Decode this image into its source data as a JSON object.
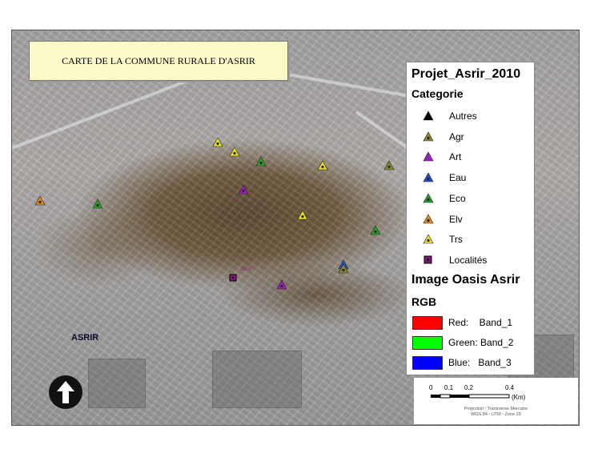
{
  "title": "CARTE DE LA COMMUNE RURALE D'ASRIR",
  "place_label": "ASRIR",
  "locality_label": "Asrir",
  "legend": {
    "title": "Projet_Asrir_2010",
    "subtitle": "Categorie",
    "items": [
      {
        "label": "Autres",
        "symbol": "triangle",
        "color": "#000000"
      },
      {
        "label": "Agr",
        "symbol": "triangle-dot",
        "color": "#8a8a2a"
      },
      {
        "label": "Art",
        "symbol": "triangle",
        "color": "#9b1fb7"
      },
      {
        "label": "Eau",
        "symbol": "triangle-dot",
        "color": "#2050c8"
      },
      {
        "label": "Eco",
        "symbol": "triangle-dot",
        "color": "#28a028"
      },
      {
        "label": "Elv",
        "symbol": "triangle-dot",
        "color": "#e08a1a"
      },
      {
        "label": "Trs",
        "symbol": "triangle-dot",
        "color": "#e8e020"
      },
      {
        "label": "Localités",
        "symbol": "square",
        "color": "#7a1a7a"
      }
    ],
    "image_title": "Image Oasis Asrir",
    "image_subtitle": "RGB",
    "bands": [
      {
        "label": "Red:    Band_1",
        "color": "#ff0000"
      },
      {
        "label": "Green: Band_2",
        "color": "#00ff00"
      },
      {
        "label": "Blue:   Band_3",
        "color": "#0000ff"
      }
    ]
  },
  "scale": {
    "ticks": [
      "0",
      "0.1",
      "0.2",
      "0.4"
    ],
    "unit": "(Km)",
    "projection_lines": [
      "Projection : Transverse Mercator",
      "WGS 84 - UTM - Zone 29"
    ]
  },
  "north_icon": "north-arrow-icon",
  "markers": [
    {
      "category": "Trs",
      "color": "#e8e020"
    },
    {
      "category": "Trs",
      "color": "#e8e020"
    },
    {
      "category": "Eco",
      "color": "#28a028"
    },
    {
      "category": "Trs",
      "color": "#e8e020"
    },
    {
      "category": "Autres",
      "color": "#8a8a2a"
    },
    {
      "category": "Art",
      "color": "#9b1fb7"
    },
    {
      "category": "Elv",
      "color": "#e08a1a"
    },
    {
      "category": "Eco",
      "color": "#28a028"
    },
    {
      "category": "Trs",
      "color": "#e8e020"
    },
    {
      "category": "Eco",
      "color": "#28a028"
    },
    {
      "category": "Eau",
      "color": "#2050c8"
    },
    {
      "category": "Art",
      "color": "#9b1fb7"
    },
    {
      "category": "Agr",
      "color": "#8a8a2a"
    }
  ]
}
